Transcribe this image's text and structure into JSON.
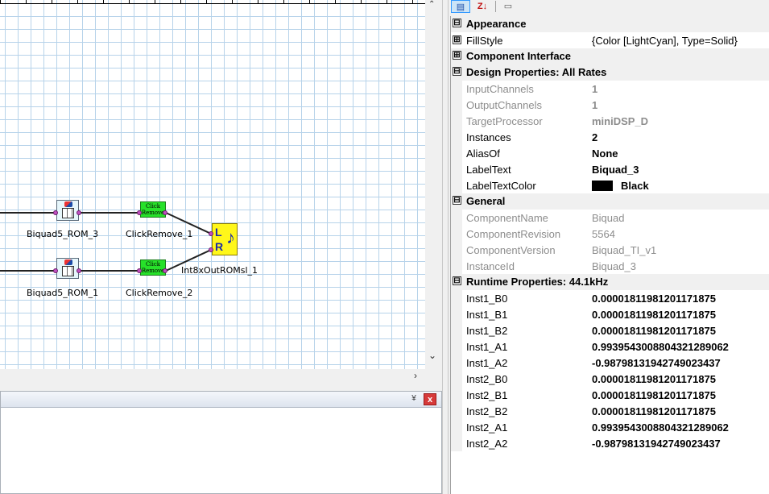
{
  "canvas": {
    "blocks": [
      {
        "name": "biquad5-rom-3",
        "label": "Biquad5_ROM_3"
      },
      {
        "name": "clickremove-1",
        "label": "ClickRemove_1",
        "caption": "Click Remove"
      },
      {
        "name": "biquad5-rom-1",
        "label": "Biquad5_ROM_1"
      },
      {
        "name": "clickremove-2",
        "label": "ClickRemove_2",
        "caption": "Click Remove"
      },
      {
        "name": "int8xoutromsl-1",
        "label": "Int8xOutROMsl_1",
        "glyph_l": "L",
        "glyph_r": "R"
      }
    ],
    "scroll_down_icon": "chevron-down-icon",
    "scroll_right_icon": "chevron-right-icon"
  },
  "bottom_panel": {
    "pin_icon": "chevron-double-down-icon",
    "close_label": "x"
  },
  "toolbar": {
    "categorized_icon": "categorized-icon",
    "alphabetical_label": "Z↓",
    "property_pages_icon": "property-pages-icon"
  },
  "properties": {
    "categories": {
      "appearance": "Appearance",
      "component_interface": "Component Interface",
      "design_properties": "Design Properties: All Rates",
      "general": "General",
      "runtime_properties": "Runtime Properties: 44.1kHz"
    },
    "fillstyle": {
      "name": "FillStyle",
      "value": "{Color [LightCyan], Type=Solid}"
    },
    "design": [
      {
        "name": "InputChannels",
        "value": "1",
        "readonly": true
      },
      {
        "name": "OutputChannels",
        "value": "1",
        "readonly": true
      },
      {
        "name": "TargetProcessor",
        "value": "miniDSP_D",
        "readonly": true
      },
      {
        "name": "Instances",
        "value": "2",
        "readonly": false
      },
      {
        "name": "AliasOf",
        "value": "None",
        "readonly": false
      },
      {
        "name": "LabelText",
        "value": "Biquad_3",
        "readonly": false
      },
      {
        "name": "LabelTextColor",
        "value": "Black",
        "readonly": false,
        "swatch_color": "#000000"
      }
    ],
    "general": [
      {
        "name": "ComponentName",
        "value": "Biquad"
      },
      {
        "name": "ComponentRevision",
        "value": "5564"
      },
      {
        "name": "ComponentVersion",
        "value": "Biquad_TI_v1"
      },
      {
        "name": "InstanceId",
        "value": "Biquad_3"
      }
    ],
    "runtime": [
      {
        "name": "Inst1_B0",
        "value": "0.00001811981201171875"
      },
      {
        "name": "Inst1_B1",
        "value": "0.00001811981201171875"
      },
      {
        "name": "Inst1_B2",
        "value": "0.00001811981201171875"
      },
      {
        "name": "Inst1_A1",
        "value": "0.9939543008804321289062"
      },
      {
        "name": "Inst1_A2",
        "value": "-0.98798131942749023437"
      },
      {
        "name": "Inst2_B0",
        "value": "0.00001811981201171875"
      },
      {
        "name": "Inst2_B1",
        "value": "0.00001811981201171875"
      },
      {
        "name": "Inst2_B2",
        "value": "0.00001811981201171875"
      },
      {
        "name": "Inst2_A1",
        "value": "0.9939543008804321289062"
      },
      {
        "name": "Inst2_A2",
        "value": "-0.98798131942749023437"
      }
    ],
    "expander_expanded": "⊟",
    "expander_collapsed": "⊞"
  }
}
